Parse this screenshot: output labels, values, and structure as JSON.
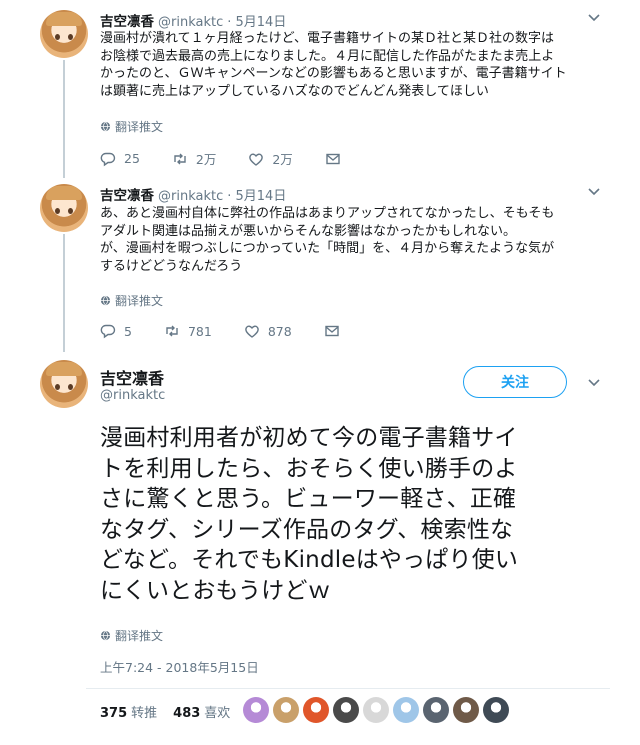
{
  "colors": {
    "accent": "#1da1f2",
    "muted": "#657786",
    "text": "#14171a",
    "thread": "#c4cfd6"
  },
  "tweets": [
    {
      "name": "吉空凛香",
      "handle": "@rinkaktc",
      "date": "· 5月14日",
      "text": "漫画村が潰れて１ヶ月経ったけど、電子書籍サイトの某Ｄ社と某Ｄ社の数字は\nお陰様で過去最高の売上になりました。４月に配信した作品がたまたま売上よ\nかったのと、ＧＷキャンペーンなどの影響もあると思いますが、電子書籍サイト\nは顕著に売上はアップしているハズなのでどんどん発表してほしい",
      "translate": "翻译推文",
      "replies": "25",
      "retweets": "2万",
      "likes": "2万"
    },
    {
      "name": "吉空凛香",
      "handle": "@rinkaktc",
      "date": "· 5月14日",
      "text": "あ、あと漫画村自体に弊社の作品はあまりアップされてなかったし、そもそも\nアダルト関連は品揃えが悪いからそんな影響はなかったかもしれない。\nが、漫画村を暇つぶしにつかっていた「時間」を、４月から奪えたような気が\nするけどどうなんだろう",
      "translate": "翻译推文",
      "replies": "5",
      "retweets": "781",
      "likes": "878"
    }
  ],
  "main_tweet": {
    "name": "吉空凛香",
    "handle": "@rinkaktc",
    "follow_label": "关注",
    "lines": [
      "漫画村利用者が初めて今の電子書籍サイ",
      "トを利用したら、おそらく使い勝手のよ",
      "さに驚くと思う。ビューワー軽さ、正確",
      "なタグ、シリーズ作品のタグ、検索性な",
      "どなど。それでもKindleはやっぱり使い",
      "にくいとおもうけどｗ"
    ],
    "translate": "翻译推文",
    "timestamp": "上午7:24 - 2018年5月15日",
    "retweets_count": "375",
    "retweets_label": "转推",
    "likes_count": "483",
    "likes_label": "喜欢",
    "liker_colors": [
      "#b58ad6",
      "#c9a06a",
      "#e0562a",
      "#4a4a4a",
      "#d8d8d8",
      "#9fc6e8",
      "#5a6470",
      "#6f5a48",
      "#3f4a55"
    ]
  },
  "icons": [
    "reply-icon",
    "retweet-icon",
    "like-icon",
    "message-icon",
    "globe-icon",
    "chevron-down-icon"
  ]
}
